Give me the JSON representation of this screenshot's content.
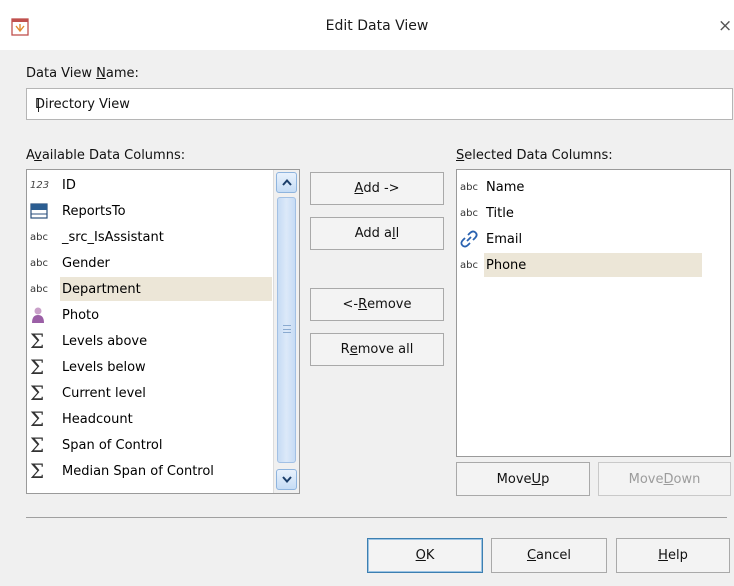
{
  "window": {
    "title": "Edit Data View",
    "close_glyph": "×",
    "icon": "app-window-icon"
  },
  "name_field": {
    "label_pre": "Data View ",
    "label_key": "N",
    "label_post": "ame:",
    "value": "Directory View"
  },
  "available": {
    "label_pre": "A",
    "label_key": "v",
    "label_post": "ailable Data Columns:",
    "items": [
      {
        "label": "ID",
        "icon": "123",
        "icon_name": "number-type-icon"
      },
      {
        "label": "ReportsTo",
        "icon": "relation",
        "icon_name": "reports-to-icon"
      },
      {
        "label": "_src_IsAssistant",
        "icon": "abc",
        "icon_name": "text-type-icon"
      },
      {
        "label": "Gender",
        "icon": "abc",
        "icon_name": "text-type-icon"
      },
      {
        "label": "Department",
        "icon": "abc",
        "icon_name": "text-type-icon",
        "highlighted": true
      },
      {
        "label": "Photo",
        "icon": "person",
        "icon_name": "photo-icon"
      },
      {
        "label": "Levels above",
        "icon": "Σ",
        "icon_name": "sigma-icon"
      },
      {
        "label": "Levels below",
        "icon": "Σ",
        "icon_name": "sigma-icon"
      },
      {
        "label": "Current level",
        "icon": "Σ",
        "icon_name": "sigma-icon"
      },
      {
        "label": "Headcount",
        "icon": "Σ",
        "icon_name": "sigma-icon"
      },
      {
        "label": "Span of Control",
        "icon": "Σ",
        "icon_name": "sigma-icon"
      },
      {
        "label": "Median Span of Control",
        "icon": "Σ",
        "icon_name": "sigma-icon"
      }
    ]
  },
  "selected": {
    "label_pre": "",
    "label_key": "S",
    "label_post": "elected Data Columns:",
    "items": [
      {
        "label": "Name",
        "icon": "abc",
        "icon_name": "text-type-icon"
      },
      {
        "label": "Title",
        "icon": "abc",
        "icon_name": "text-type-icon"
      },
      {
        "label": "Email",
        "icon": "link",
        "icon_name": "link-icon"
      },
      {
        "label": "Phone",
        "icon": "abc",
        "icon_name": "text-type-icon",
        "highlighted": true
      }
    ]
  },
  "buttons": {
    "add": {
      "pre": "",
      "key": "A",
      "post": "dd ->"
    },
    "add_all": {
      "pre": "Add a",
      "key": "l",
      "post": "l"
    },
    "remove": {
      "pre": "<- ",
      "key": "R",
      "post": "emove"
    },
    "remove_all": {
      "pre": "R",
      "key": "e",
      "post": "move all"
    },
    "move_up": {
      "pre": "Move ",
      "key": "U",
      "post": "p"
    },
    "move_down": {
      "pre": "Move ",
      "key": "D",
      "post": "own"
    },
    "ok": {
      "pre": "",
      "key": "O",
      "post": "K"
    },
    "cancel": {
      "pre": "",
      "key": "C",
      "post": "ancel"
    },
    "help": {
      "pre": "",
      "key": "H",
      "post": "elp"
    }
  }
}
